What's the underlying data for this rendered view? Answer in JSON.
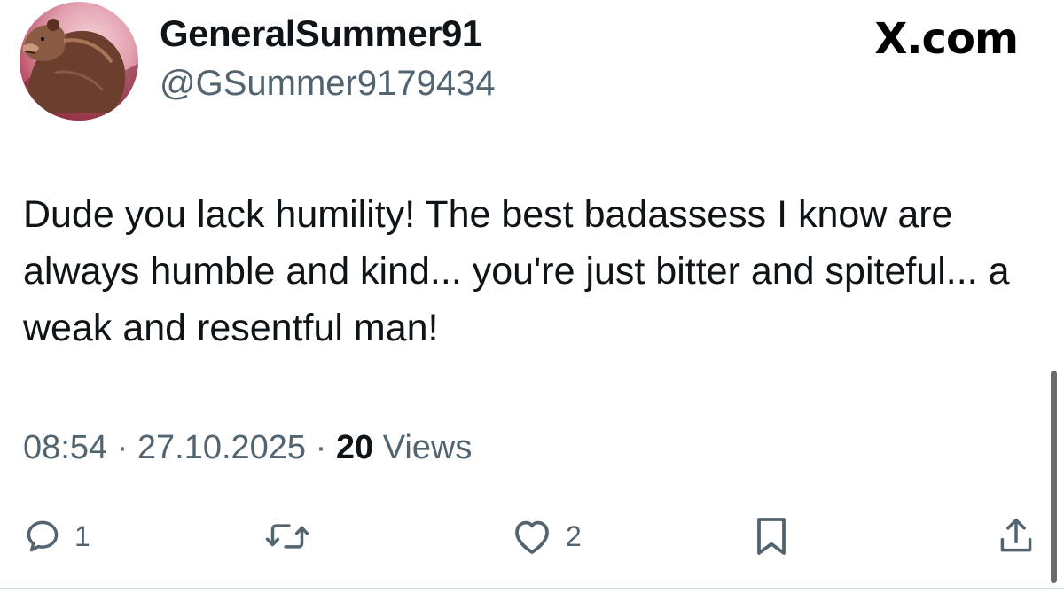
{
  "author": {
    "display_name": "GeneralSummer91",
    "handle": "@GSummer9179434",
    "avatar_icon": "bear-avatar"
  },
  "site": {
    "brand": "X.com"
  },
  "tweet": {
    "text": "Dude you lack humility! The best badassess I know are always humble and kind... you're just bitter and spiteful... a weak and resentful man!"
  },
  "meta": {
    "time": "08:54",
    "separator": "·",
    "date": "27.10.2025",
    "views_count": "20",
    "views_label": "Views"
  },
  "actions": {
    "reply_count": "1",
    "retweet_count": "",
    "like_count": "2",
    "icons": {
      "reply": "reply-icon",
      "retweet": "retweet-icon",
      "like": "heart-icon",
      "bookmark": "bookmark-icon",
      "share": "share-icon"
    }
  },
  "colors": {
    "text_primary": "#0f1419",
    "text_secondary": "#536471",
    "divider": "#cfd9de"
  }
}
